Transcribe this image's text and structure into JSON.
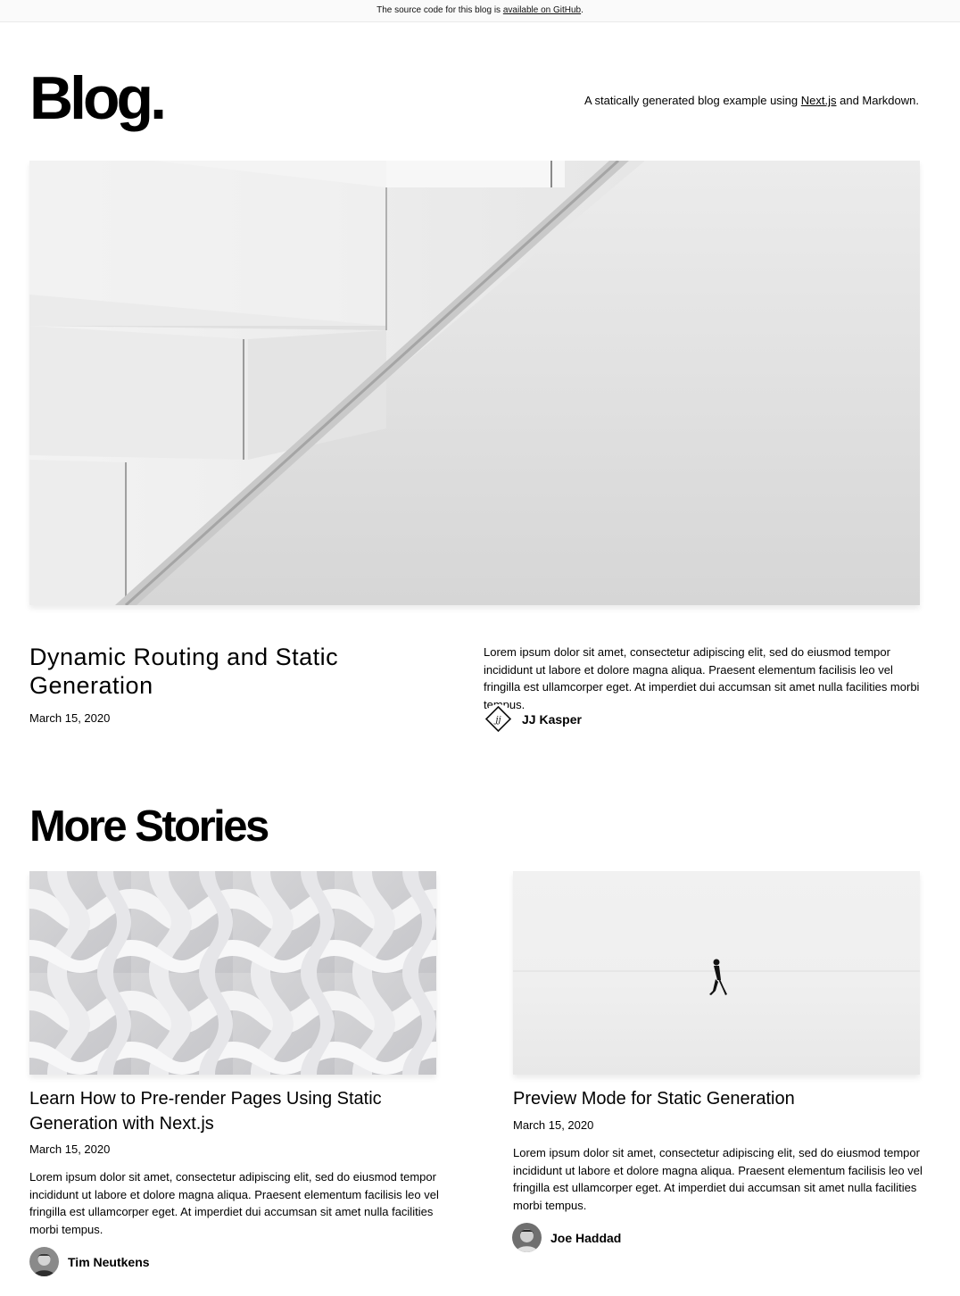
{
  "banner": {
    "text_before": "The source code for this blog is ",
    "link_text": "available on GitHub",
    "text_after": "."
  },
  "header": {
    "logo": "Blog.",
    "tagline_before": "A statically generated blog example using ",
    "tagline_link": "Next.js",
    "tagline_after": " and Markdown."
  },
  "hero": {
    "title": "Dynamic Routing and Static Generation",
    "date": "March 15, 2020",
    "excerpt": "Lorem ipsum dolor sit amet, consectetur adipiscing elit, sed do eiusmod tempor incididunt ut labore et dolore magna aliqua. Praesent elementum facilisis leo vel fringilla est ullamcorper eget. At imperdiet dui accumsan sit amet nulla facilities morbi tempus.",
    "author": "JJ Kasper",
    "avatar_initials": "jj"
  },
  "more_stories": {
    "heading": "More Stories",
    "posts": [
      {
        "title": "Learn How to Pre-render Pages Using Static Generation with Next.js",
        "date": "March 15, 2020",
        "excerpt": "Lorem ipsum dolor sit amet, consectetur adipiscing elit, sed do eiusmod tempor incididunt ut labore et dolore magna aliqua. Praesent elementum facilisis leo vel fringilla est ullamcorper eget. At imperdiet dui accumsan sit amet nulla facilities morbi tempus.",
        "author": "Tim Neutkens"
      },
      {
        "title": "Preview Mode for Static Generation",
        "date": "March 15, 2020",
        "excerpt": "Lorem ipsum dolor sit amet, consectetur adipiscing elit, sed do eiusmod tempor incididunt ut labore et dolore magna aliqua. Praesent elementum facilisis leo vel fringilla est ullamcorper eget. At imperdiet dui accumsan sit amet nulla facilities morbi tempus.",
        "author": "Joe Haddad"
      }
    ]
  }
}
